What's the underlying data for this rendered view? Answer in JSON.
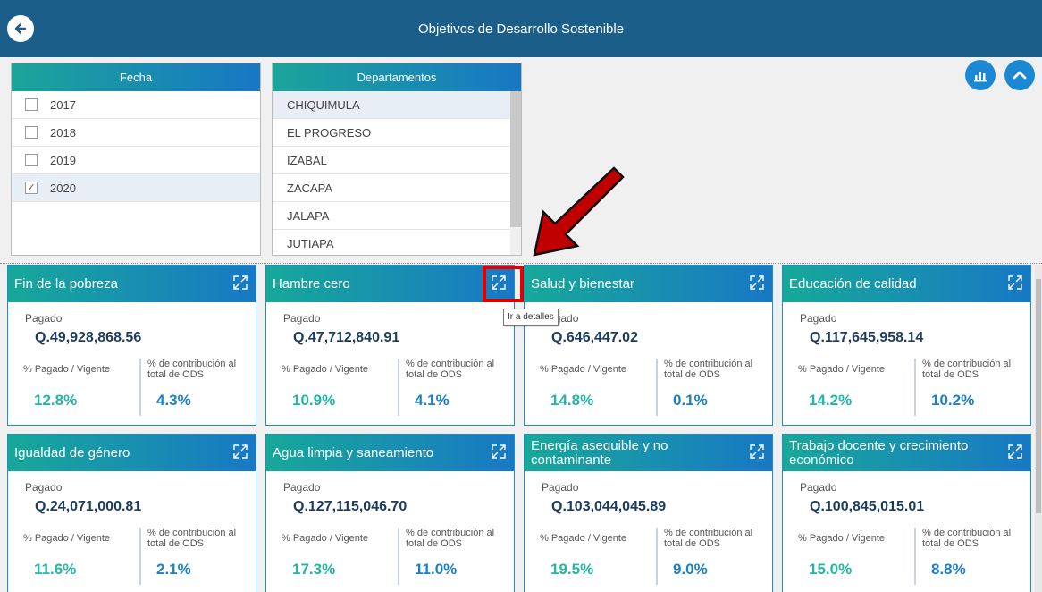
{
  "header": {
    "title": "Objetivos de Desarrollo Sostenible"
  },
  "fecha": {
    "title": "Fecha",
    "items": [
      {
        "label": "2017",
        "checked": false
      },
      {
        "label": "2018",
        "checked": false
      },
      {
        "label": "2019",
        "checked": false
      },
      {
        "label": "2020",
        "checked": true
      }
    ]
  },
  "departamentos": {
    "title": "Departamentos",
    "items": [
      "CHIQUIMULA",
      "EL PROGRESO",
      "IZABAL",
      "ZACAPA",
      "JALAPA",
      "JUTIAPA"
    ]
  },
  "card_labels": {
    "pagado": "Pagado",
    "pct": "% Pagado / Vigente",
    "contrib": "% de contribución al total de ODS"
  },
  "cards": [
    {
      "title": "Fin de la pobreza",
      "pagado": "Q.49,928,868.56",
      "pct": "12.8%",
      "contrib": "4.3%"
    },
    {
      "title": "Hambre cero",
      "pagado": "Q.47,712,840.91",
      "pct": "10.9%",
      "contrib": "4.1%"
    },
    {
      "title": "Salud y bienestar",
      "pagado": "Q.646,447.02",
      "pct": "14.8%",
      "contrib": "0.1%"
    },
    {
      "title": "Educación de calidad",
      "pagado": "Q.117,645,958.14",
      "pct": "14.2%",
      "contrib": "10.2%"
    },
    {
      "title": "Igualdad de género",
      "pagado": "Q.24,071,000.81",
      "pct": "11.6%",
      "contrib": "2.1%"
    },
    {
      "title": "Agua limpia y saneamiento",
      "pagado": "Q.127,115,046.70",
      "pct": "17.3%",
      "contrib": "11.0%"
    },
    {
      "title": "Energía asequible y no contaminante",
      "pagado": "Q.103,044,045.89",
      "pct": "19.5%",
      "contrib": "9.0%"
    },
    {
      "title": "Trabajo docente y crecimiento económico",
      "pagado": "Q.100,845,015.01",
      "pct": "15.0%",
      "contrib": "8.8%"
    }
  ],
  "tooltip": {
    "text": "Ir a detalles"
  },
  "icons": {
    "back": "arrow-left-icon",
    "chart": "bar-chart-icon",
    "collapse": "chevron-up-icon",
    "expand": "expand-icon"
  },
  "colors": {
    "header_bg": "#1b5e8a",
    "gradient_start": "#17a89a",
    "gradient_end": "#1878c4",
    "pct_value": "#23b6a5",
    "contrib_value": "#1c80c9",
    "highlight": "#e00000"
  }
}
